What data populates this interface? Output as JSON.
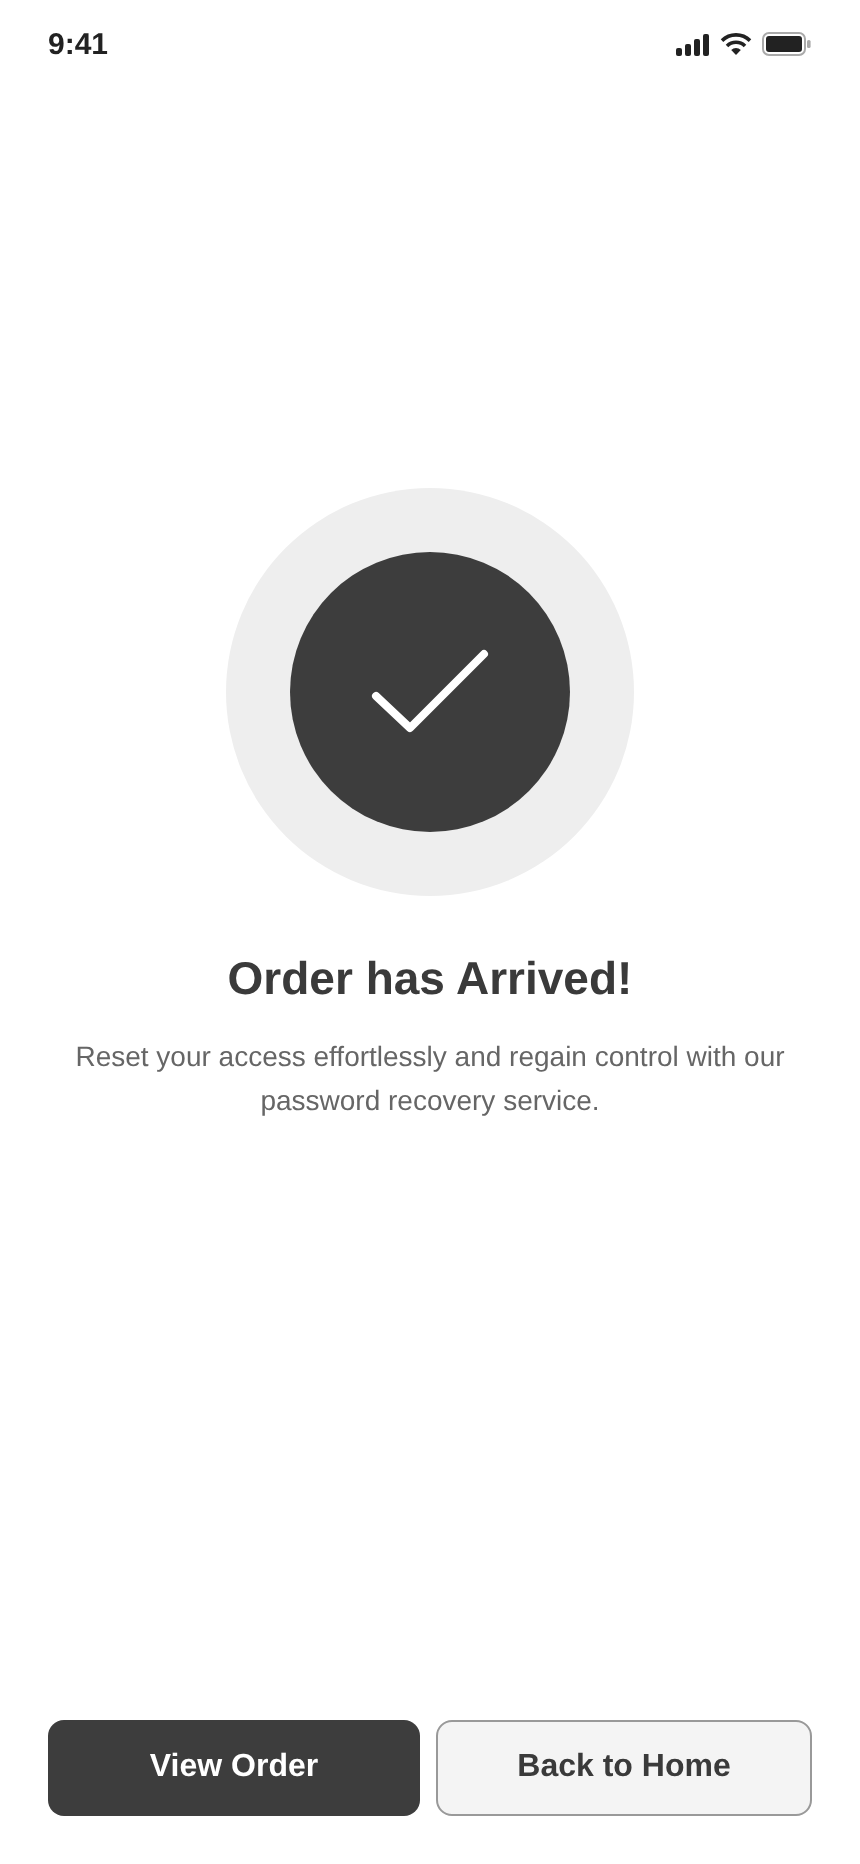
{
  "status_bar": {
    "time": "9:41"
  },
  "title": "Order has Arrived!",
  "message": "Reset your access effortlessly and regain control with our password recovery service.",
  "buttons": [
    {
      "label": "View Order",
      "kind": "primary"
    },
    {
      "label": "Back to Home",
      "kind": "secondary"
    }
  ]
}
